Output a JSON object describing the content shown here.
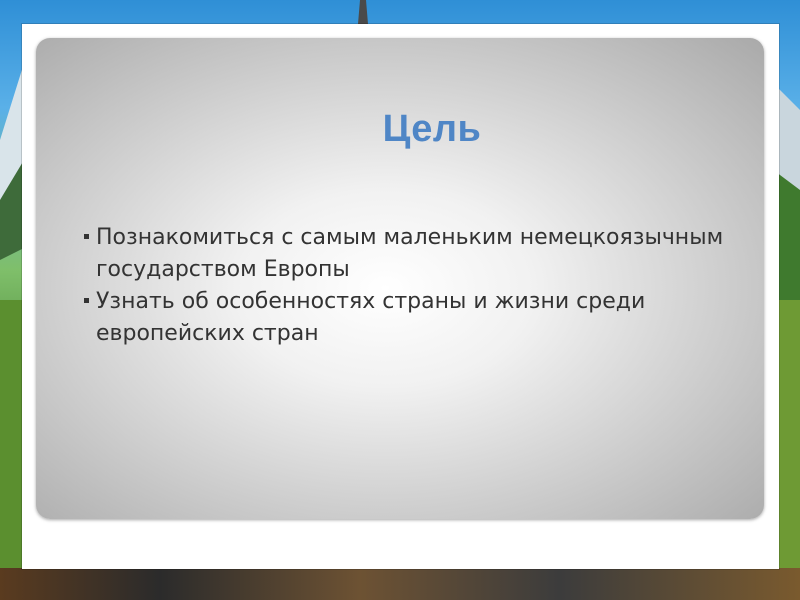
{
  "slide": {
    "title": "Цель",
    "bullets": [
      {
        "text": "Познакомиться с самым маленьким немецкоязычным государством  Европы"
      },
      {
        "text": "Узнать об особенностях страны и жизни среди европейских стран"
      }
    ]
  },
  "colors": {
    "title": "#4f86c6",
    "text": "#333333"
  }
}
